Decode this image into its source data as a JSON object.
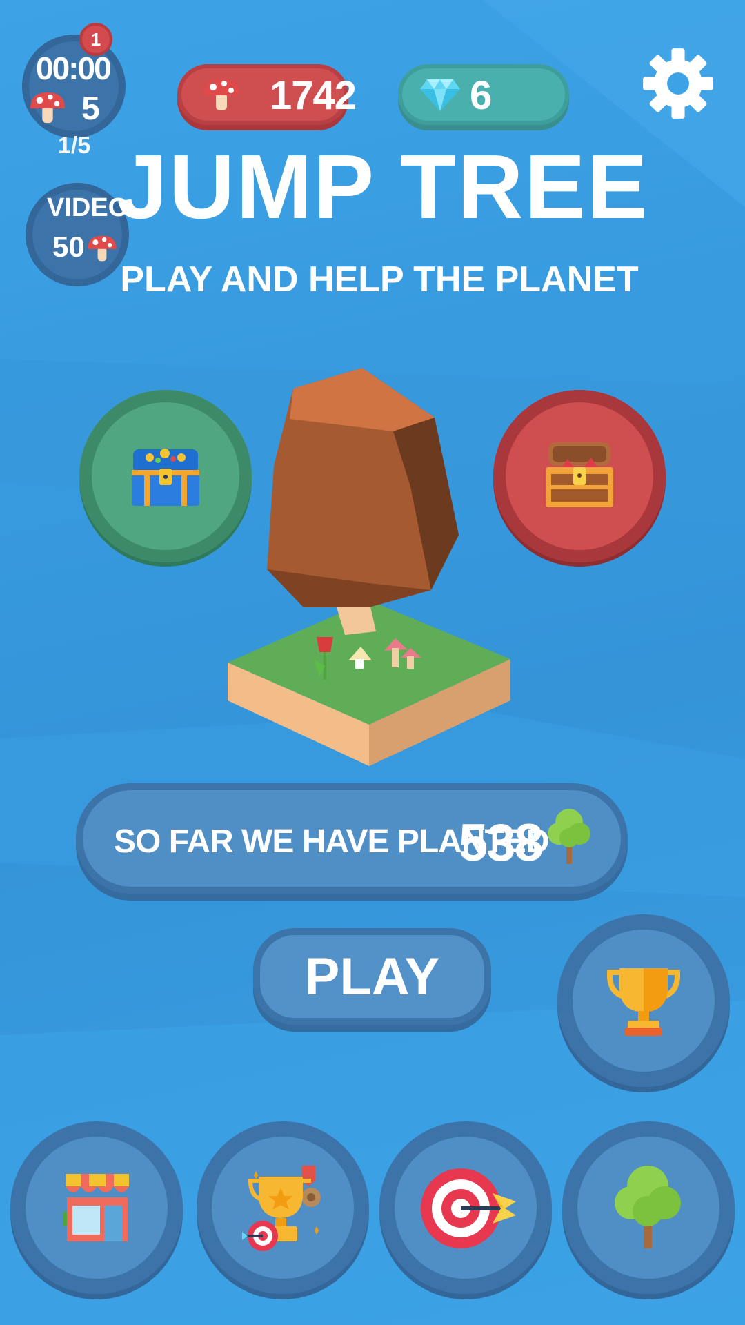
{
  "title": "JUMP TREE",
  "subtitle": "PLAY AND HELP THE PLANET",
  "timer": {
    "notification_count": "1",
    "time": "00:00",
    "mushrooms": "5",
    "progress": "1/5"
  },
  "video_reward": {
    "label": "VIDEO",
    "amount": "50"
  },
  "currency": {
    "mushrooms": "1742",
    "gems": "6"
  },
  "planted": {
    "label": "SO FAR  WE HAVE PLANTED",
    "count": "538"
  },
  "play_label": "PLAY",
  "icons": {
    "settings": "gear-icon",
    "gem": "diamond-icon",
    "mushroom": "mushroom-icon",
    "green_chest": "treasure-chest-icon",
    "red_chest": "open-chest-icon",
    "leaderboard": "trophy-icon",
    "shop": "shop-icon",
    "achievements": "achievements-icon",
    "missions": "target-icon",
    "trees": "tree-icon"
  },
  "colors": {
    "background": "#3a9ce0",
    "button_blue": "#4f8fc6",
    "button_ring": "#3c73a8",
    "mushroom_red": "#cf4e4f",
    "gem_teal": "#49b0ad",
    "chest_green": "#4fa67f"
  }
}
